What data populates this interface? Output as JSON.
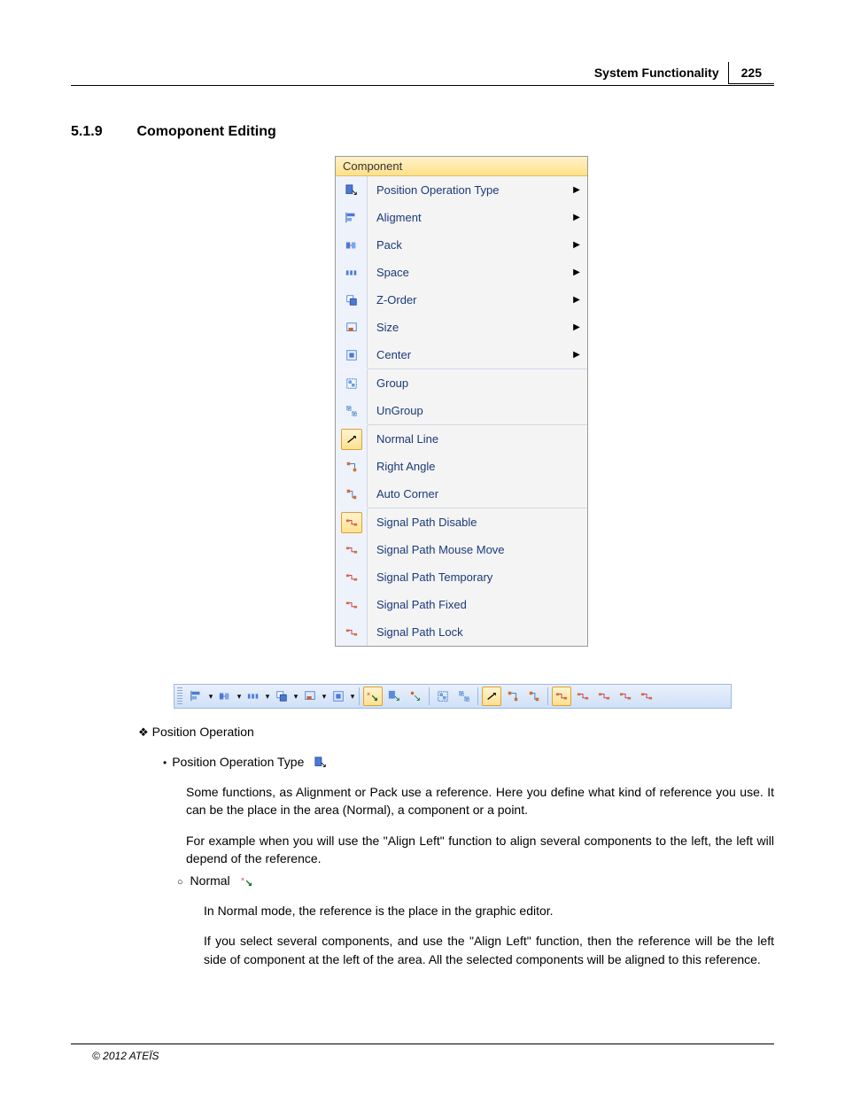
{
  "header": {
    "title": "System Functionality",
    "page": "225"
  },
  "section": {
    "number": "5.1.9",
    "title": "Comoponent Editing"
  },
  "menu": {
    "title": "Component",
    "items": [
      {
        "label": "Position Operation Type",
        "sub": true,
        "icon": "position-op-icon"
      },
      {
        "label": "Aligment",
        "sub": true,
        "icon": "alignment-icon"
      },
      {
        "label": "Pack",
        "sub": true,
        "icon": "pack-icon"
      },
      {
        "label": "Space",
        "sub": true,
        "icon": "space-icon"
      },
      {
        "label": "Z-Order",
        "sub": true,
        "icon": "zorder-icon"
      },
      {
        "label": "Size",
        "sub": true,
        "icon": "size-icon"
      },
      {
        "label": "Center",
        "sub": true,
        "icon": "center-icon",
        "sepAfter": true
      },
      {
        "label": "Group",
        "sub": false,
        "icon": "group-icon"
      },
      {
        "label": "UnGroup",
        "sub": false,
        "icon": "ungroup-icon",
        "sepAfter": true
      },
      {
        "label": "Normal Line",
        "sub": false,
        "icon": "normal-line-icon",
        "highlight": true
      },
      {
        "label": "Right Angle",
        "sub": false,
        "icon": "right-angle-icon"
      },
      {
        "label": "Auto Corner",
        "sub": false,
        "icon": "auto-corner-icon",
        "sepAfter": true
      },
      {
        "label": "Signal Path Disable",
        "sub": false,
        "icon": "sp-disable-icon",
        "highlight": true
      },
      {
        "label": "Signal Path Mouse Move",
        "sub": false,
        "icon": "sp-mouse-icon"
      },
      {
        "label": "Signal Path Temporary",
        "sub": false,
        "icon": "sp-temp-icon"
      },
      {
        "label": "Signal Path Fixed",
        "sub": false,
        "icon": "sp-fixed-icon"
      },
      {
        "label": "Signal Path Lock",
        "sub": false,
        "icon": "sp-lock-icon"
      }
    ]
  },
  "toolbar": {
    "groups": [
      [
        "alignment-icon",
        "drop",
        "pack-icon",
        "drop",
        "space-icon",
        "drop",
        "zorder-icon",
        "drop",
        "size-icon",
        "drop",
        "center-icon",
        "drop"
      ],
      [
        "pos-normal-icon|on",
        "pos-component-icon",
        "pos-point-icon"
      ],
      [
        "group-icon",
        "ungroup-icon"
      ],
      [
        "normal-line-icon|on",
        "right-angle-icon",
        "auto-corner-icon"
      ],
      [
        "sp-disable-icon|on",
        "sp-mouse-icon",
        "sp-temp-icon",
        "sp-fixed-icon",
        "sp-lock-icon"
      ]
    ]
  },
  "body": {
    "h_position_operation": "Position Operation",
    "bullet_pot": "Position Operation Type",
    "p1": "Some functions, as Alignment or Pack use a reference. Here you define what kind of reference you use. It can be the place in the area (Normal), a component or a point.",
    "p2": "For example when you will use the \"Align Left\" function to align several components to the left, the left will depend of the reference.",
    "sub_normal": "Normal",
    "p3": "In Normal mode, the reference is the place in the graphic editor.",
    "p4": "If you select several components, and use the \"Align Left\" function, then the reference will be the left side of component at the left of the area. All the selected components will be aligned to this reference."
  },
  "footer": {
    "copyright": "© 2012 ATEÏS"
  }
}
